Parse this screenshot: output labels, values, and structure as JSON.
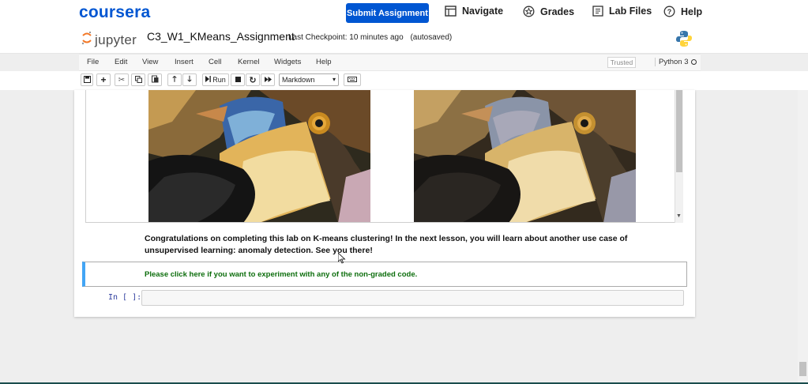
{
  "coursera": {
    "logo": "coursera",
    "submit_label": "Submit Assignment",
    "nav": [
      {
        "label": "Navigate",
        "icon": "navigate-icon"
      },
      {
        "label": "Grades",
        "icon": "grades-icon"
      },
      {
        "label": "Lab Files",
        "icon": "lab-files-icon"
      },
      {
        "label": "Help",
        "icon": "help-icon"
      }
    ],
    "brand_color": "#0056d2"
  },
  "jupyter": {
    "logo_text": "jupyter",
    "notebook_name": "C3_W1_KMeans_Assignment",
    "checkpoint": "Last Checkpoint: 10 minutes ago",
    "autosave": "(autosaved)",
    "menu": [
      "File",
      "Edit",
      "View",
      "Insert",
      "Cell",
      "Kernel",
      "Widgets",
      "Help"
    ],
    "trusted": "Trusted",
    "kernel": "Python 3",
    "run_label": "Run",
    "cell_type": "Markdown"
  },
  "notebook": {
    "congrats_text": "Congratulations on completing this lab on K-means clustering! In the next lesson, you will learn about another use case of unsupervised learning: anomaly detection. See you there!",
    "link_text": "Please click here if you want to experiment with any of the non-graded code.",
    "input_prompt": "In [ ]:"
  }
}
